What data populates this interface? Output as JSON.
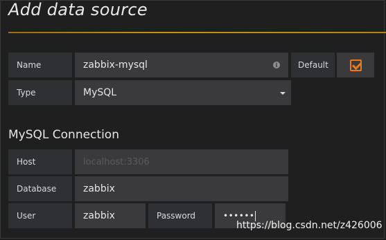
{
  "page": {
    "title": "Add data source"
  },
  "form": {
    "name": {
      "label": "Name",
      "value": "zabbix-mysql"
    },
    "default": {
      "label": "Default",
      "checked": true
    },
    "type": {
      "label": "Type",
      "value": "MySQL"
    }
  },
  "connection": {
    "title": "MySQL Connection",
    "host": {
      "label": "Host",
      "placeholder": "localhost:3306",
      "value": ""
    },
    "database": {
      "label": "Database",
      "value": "zabbix"
    },
    "user": {
      "label": "User",
      "value": "zabbix"
    },
    "password": {
      "label": "Password",
      "value": "••••••"
    }
  },
  "colors": {
    "accent": "#eb7b18",
    "rule": "#c9901d",
    "background": "#1f1f20"
  },
  "icons": {
    "info": "info-icon",
    "dropdown": "caret-down-icon",
    "checkbox": "checkbox-checked-icon"
  },
  "watermark": "https://blog.csdn.net/z426006"
}
